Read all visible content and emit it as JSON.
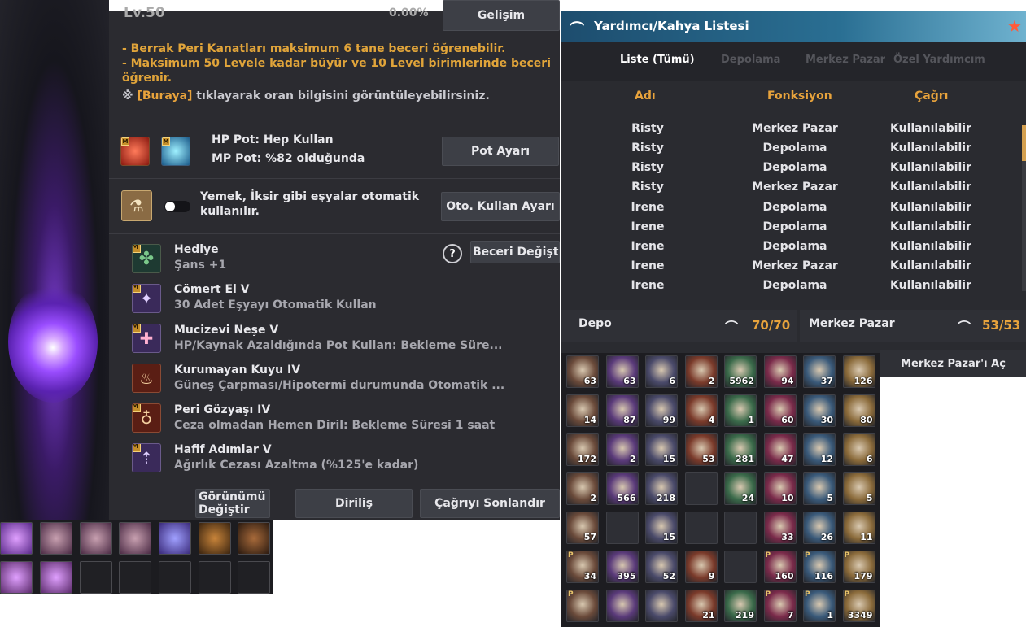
{
  "left": {
    "level": "Lv.50",
    "progress_pct": "0.00%",
    "develop_btn": "Gelişim",
    "info_lines": [
      "- Berrak Peri Kanatları maksimum 6 tane beceri öğrenebilir.",
      "- Maksimum 50 Levele kadar büyür ve 10 Level birimlerinde beceri",
      "öğrenir."
    ],
    "info_link_prefix": "※ ",
    "info_link": "[Buraya]",
    "info_link_suffix": " tıklayarak oran bilgisini görüntüleyebilirsiniz.",
    "hp_pot": "HP Pot: Hep Kullan",
    "mp_pot": "MP Pot: %82 olduğunda",
    "pot_btn": "Pot Ayarı",
    "auto_text_1": "Yemek, İksir gibi eşyalar otomatik",
    "auto_text_2": "kullanılır.",
    "auto_btn": "Oto. Kullan Ayarı",
    "skill_change_btn": "Beceri Değiştir",
    "help_icon": "?",
    "m_badge": "M",
    "skills": [
      {
        "name": "Hediye",
        "desc": "Şans +1"
      },
      {
        "name": "Cömert El V",
        "desc": "30 Adet Eşyayı Otomatik Kullan"
      },
      {
        "name": "Mucizevi Neşe V",
        "desc": "HP/Kaynak Azaldığında Pot Kullan: Bekleme Süre..."
      },
      {
        "name": "Kurumayan Kuyu IV",
        "desc": "Güneş Çarpması/Hipotermi durumunda Otomatik ..."
      },
      {
        "name": "Peri Gözyaşı IV",
        "desc": "Ceza olmadan Hemen Diril: Bekleme Süresi 1 saat"
      },
      {
        "name": "Hafif Adımlar V",
        "desc": "Ağırlık Cezası Azaltma (%125'e kadar)"
      }
    ],
    "view_btn_1": "Görünümü",
    "view_btn_2": "Değiştir",
    "revive_btn": "Diriliş",
    "end_call_btn": "Çağrıyı Sonlandır"
  },
  "right": {
    "title": "Yardımcı/Kahya Listesi",
    "tabs": [
      "Liste (Tümü)",
      "Depolama",
      "Merkez Pazar",
      "Özel Yardımcım"
    ],
    "columns": [
      "Adı",
      "Fonksiyon",
      "Çağrı"
    ],
    "rows": [
      [
        "Risty",
        "Merkez Pazar",
        "Kullanılabilir"
      ],
      [
        "Risty",
        "Depolama",
        "Kullanılabilir"
      ],
      [
        "Risty",
        "Depolama",
        "Kullanılabilir"
      ],
      [
        "Risty",
        "Merkez Pazar",
        "Kullanılabilir"
      ],
      [
        "Irene",
        "Depolama",
        "Kullanılabilir"
      ],
      [
        "Irene",
        "Depolama",
        "Kullanılabilir"
      ],
      [
        "Irene",
        "Depolama",
        "Kullanılabilir"
      ],
      [
        "Irene",
        "Merkez Pazar",
        "Kullanılabilir"
      ],
      [
        "Irene",
        "Depolama",
        "Kullanılabilir"
      ]
    ],
    "depot_label": "Depo",
    "depot_count": "70/70",
    "market_label": "Merkez Pazar",
    "market_count": "53/53",
    "open_market_btn": "Merkez Pazar'ı Aç"
  },
  "inventory_counts": [
    "63",
    "63",
    "6",
    "2",
    "5962",
    "94",
    "37",
    "126",
    "14",
    "87",
    "99",
    "4",
    "1",
    "60",
    "30",
    "80",
    "172",
    "2",
    "15",
    "53",
    "281",
    "47",
    "12",
    "6",
    "2",
    "566",
    "218",
    "",
    "24",
    "10",
    "5",
    "5",
    "57",
    "",
    "15",
    "",
    "",
    "33",
    "26",
    "11",
    "34",
    "395",
    "52",
    "9",
    "",
    "160",
    "116",
    "179",
    "",
    "",
    "",
    "21",
    "219",
    "7",
    "1",
    "3349"
  ],
  "inventory_p_badge": "P",
  "colors": {
    "accent_orange": "#e8a33c",
    "header_blue": "#2a6f93",
    "panel": "#2b2b30"
  }
}
